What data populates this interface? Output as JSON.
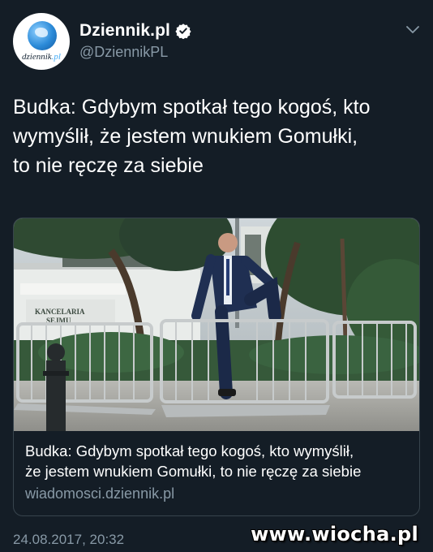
{
  "author": {
    "display_name": "Dziennik.pl",
    "handle": "@DziennikPL",
    "verified": true,
    "avatar_wordmark": "dziennik",
    "avatar_wordmark_suffix": ".pl"
  },
  "tweet": {
    "line1": "Budka: Gdybym spotkał tego kogoś, kto",
    "line2": "wymyślił, że jestem wnukiem Gomułki,",
    "line3": "to nie ręczę za siebie",
    "timestamp": "24.08.2017, 20:32"
  },
  "card": {
    "title_line1": "Budka: Gdybym spotkał tego kogoś, kto wymyślił,",
    "title_line2": "że jestem wnukiem Gomułki, to nie ręczę za siebie",
    "domain": "wiadomosci.dziennik.pl",
    "sign_line1": "KANCELARIA",
    "sign_line2": "SEJMU"
  },
  "watermark": "www.wiocha.pl",
  "colors": {
    "background": "#141d26",
    "secondary_text": "#8899a6",
    "verified": "#ffffff",
    "border": "#38444d"
  },
  "icons": {
    "verified": "verified-badge-icon",
    "menu": "chevron-down-icon"
  }
}
